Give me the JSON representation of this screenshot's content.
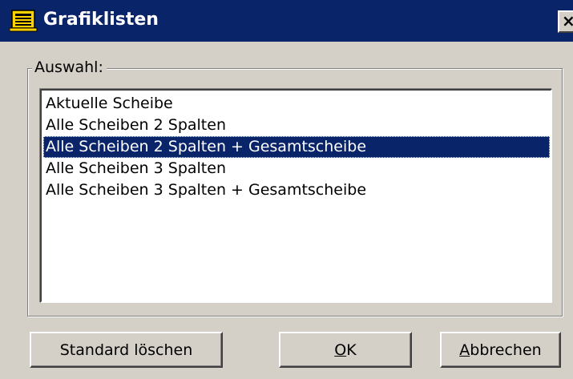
{
  "window": {
    "title": "Grafiklisten",
    "close_glyph": "×",
    "icon": "list-window-icon"
  },
  "group": {
    "label": "Auswahl:"
  },
  "list": {
    "items": [
      {
        "label": "Aktuelle Scheibe",
        "selected": false
      },
      {
        "label": "Alle Scheiben 2 Spalten",
        "selected": false
      },
      {
        "label": "Alle Scheiben 2 Spalten + Gesamtscheibe",
        "selected": true
      },
      {
        "label": "Alle Scheiben 3 Spalten",
        "selected": false
      },
      {
        "label": "Alle Scheiben 3 Spalten + Gesamtscheibe",
        "selected": false
      }
    ]
  },
  "buttons": {
    "standard_label": "Standard löschen",
    "ok": {
      "mnemonic": "O",
      "rest": "K"
    },
    "cancel": {
      "mnemonic": "A",
      "rest": "bbrechen"
    }
  },
  "colors": {
    "titlebar": "#0a246a",
    "face": "#d4d0c8",
    "selection": "#0a246a"
  }
}
